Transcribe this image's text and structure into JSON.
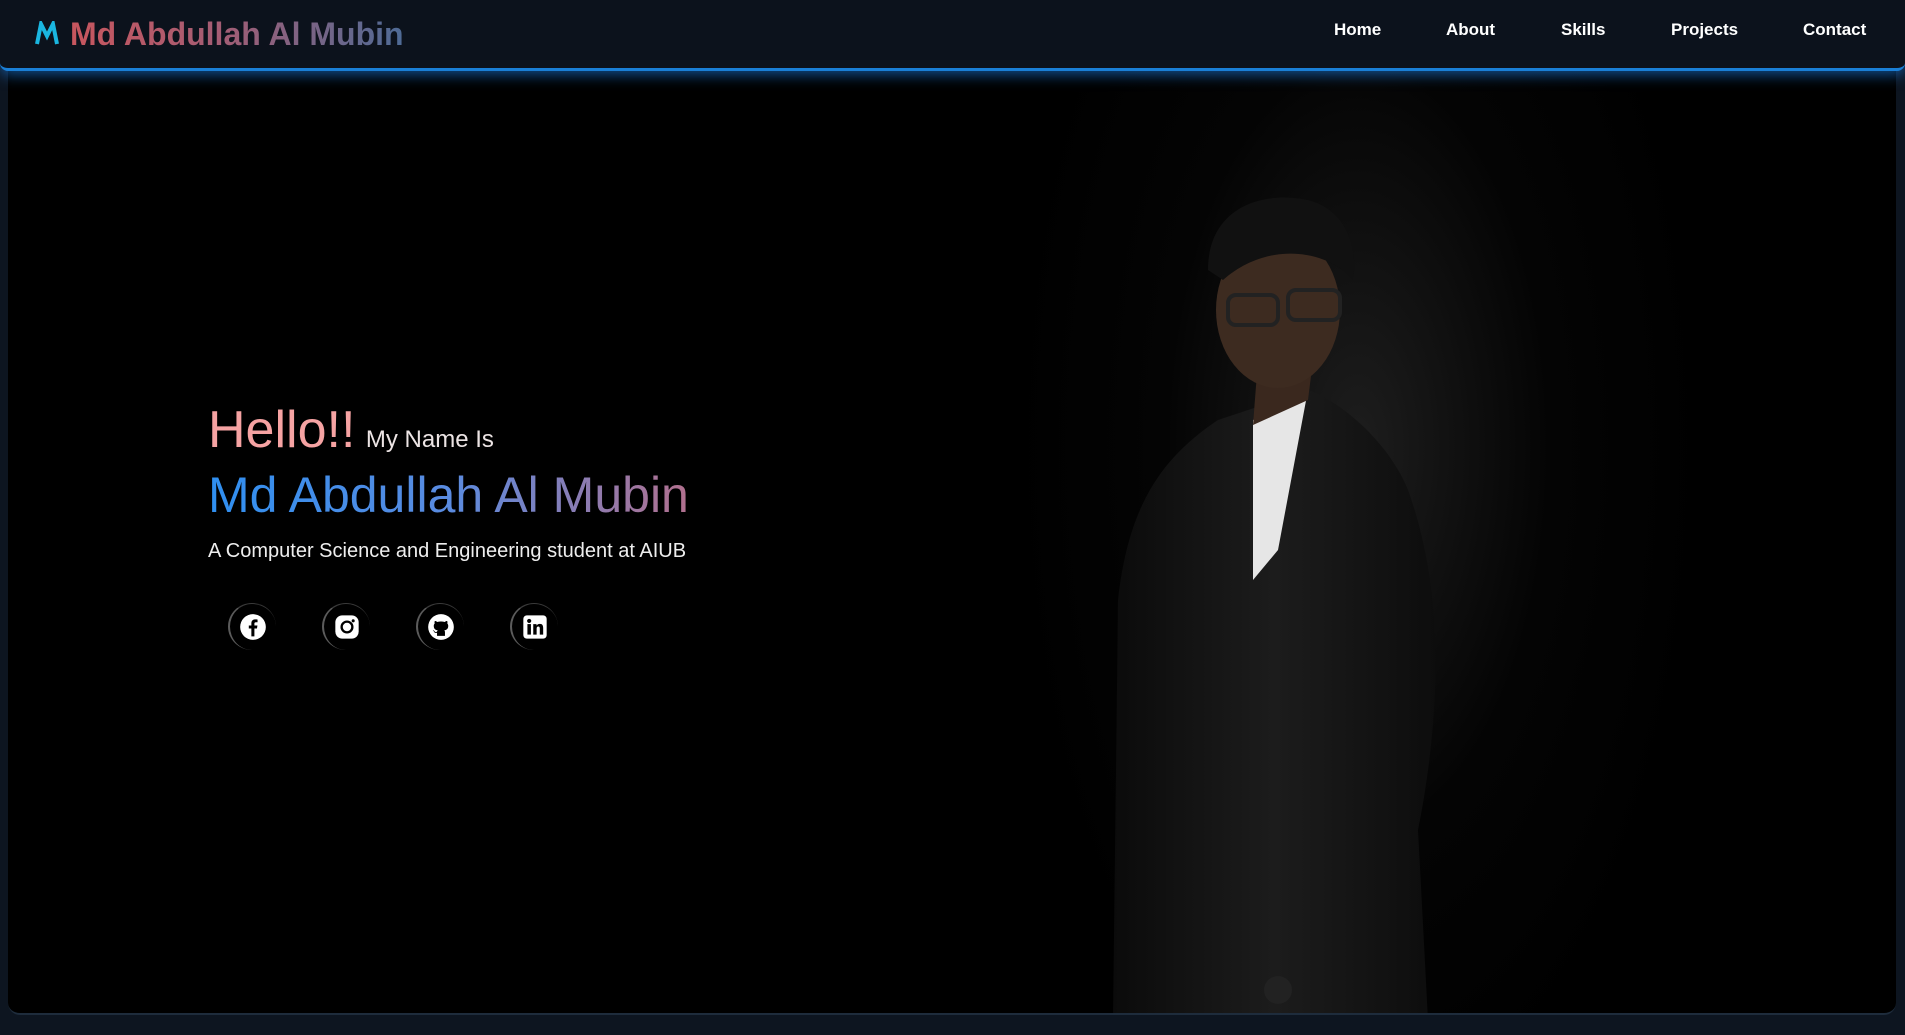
{
  "brand": {
    "name": "Md Abdullah Al Mubin",
    "logo_icon": "m-logo-icon"
  },
  "nav": {
    "items": [
      {
        "label": "Home"
      },
      {
        "label": "About"
      },
      {
        "label": "Skills"
      },
      {
        "label": "Projects"
      },
      {
        "label": "Contact"
      }
    ]
  },
  "hero": {
    "greeting": "Hello!!",
    "subgreeting": "My Name Is",
    "name": "Md Abdullah Al Mubin",
    "tagline": "A Computer Science and Engineering student at AIUB",
    "socials": [
      {
        "icon": "facebook-icon"
      },
      {
        "icon": "instagram-icon"
      },
      {
        "icon": "github-icon"
      },
      {
        "icon": "linkedin-icon"
      }
    ]
  },
  "colors": {
    "accent_blue": "#1a7fd6",
    "brand_red": "#c8565e",
    "hello_pink": "#f6a3a3",
    "name_blue": "#2f8ff0"
  }
}
